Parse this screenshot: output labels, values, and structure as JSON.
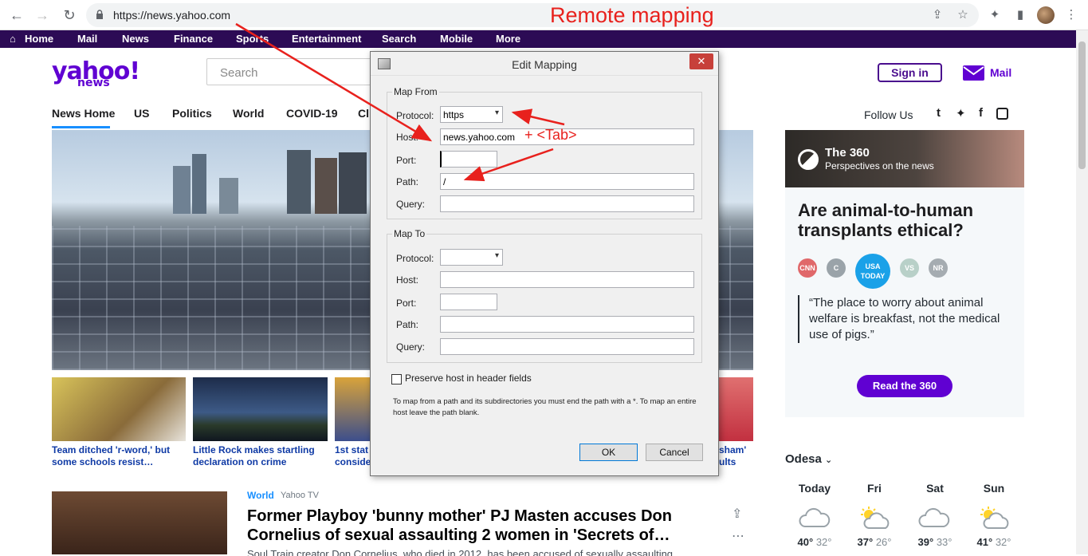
{
  "browser": {
    "url": "https://news.yahoo.com",
    "annotation": "Remote mapping"
  },
  "ynav": {
    "items": [
      "Home",
      "Mail",
      "News",
      "Finance",
      "Sports",
      "Entertainment",
      "Search",
      "Mobile",
      "More"
    ]
  },
  "header": {
    "logo": "yahoo!",
    "logo_sub": "news",
    "search_placeholder": "Search",
    "signin_label": "Sign in",
    "mail_label": "Mail"
  },
  "subnav": {
    "items": [
      "News Home",
      "US",
      "Politics",
      "World",
      "COVID-19",
      "Cli"
    ],
    "follow_label": "Follow Us"
  },
  "thumbs": [
    {
      "caption_line1": "Team ditched 'r-word,' but",
      "caption_line2": "some schools resist…"
    },
    {
      "caption_line1": "Little Rock makes startling",
      "caption_line2": "declaration on crime"
    },
    {
      "caption_line1": "1st stat",
      "caption_line2": "conside"
    },
    {
      "caption_line1": "sham'",
      "caption_line2": "ults"
    }
  ],
  "article": {
    "category": "World",
    "source": "Yahoo TV",
    "title": "Former Playboy 'bunny mother' PJ Masten accuses Don Cornelius of sexual assaulting 2 women in 'Secrets of…",
    "snippet": "Soul Train creator Don Cornelius, who died in 2012, has been accused of sexually assaulting"
  },
  "card360": {
    "title": "The 360",
    "subtitle": "Perspectives on the news",
    "question": "Are animal-to-human transplants ethical?",
    "sources": [
      "CNN",
      "C",
      "USA TODAY",
      "VS",
      "NR"
    ],
    "quote": "“The place to worry about animal welfare is breakfast, not the medical use of pigs.”",
    "button": "Read the 360"
  },
  "weather": {
    "city": "Odesa",
    "days": [
      {
        "day": "Today",
        "hi": "40°",
        "lo": "32°"
      },
      {
        "day": "Fri",
        "hi": "37°",
        "lo": "26°"
      },
      {
        "day": "Sat",
        "hi": "39°",
        "lo": "33°"
      },
      {
        "day": "Sun",
        "hi": "41°",
        "lo": "32°"
      }
    ]
  },
  "dialog": {
    "title": "Edit Mapping",
    "close": "✕",
    "map_from": {
      "label": "Map From",
      "protocol_label": "Protocol:",
      "protocol_value": "https",
      "host_label": "Host:",
      "host_value": "news.yahoo.com",
      "port_label": "Port:",
      "port_value": "",
      "path_label": "Path:",
      "path_value": "/",
      "query_label": "Query:",
      "query_value": ""
    },
    "map_to": {
      "label": "Map To",
      "protocol_label": "Protocol:",
      "protocol_value": "",
      "host_label": "Host:",
      "host_value": "",
      "port_label": "Port:",
      "port_value": "",
      "path_label": "Path:",
      "path_value": "",
      "query_label": "Query:",
      "query_value": ""
    },
    "preserve_label": "Preserve host in header fields",
    "hint": "To map from a path and its subdirectories you must end the path with a *. To map an entire host leave the path blank.",
    "ok_label": "OK",
    "cancel_label": "Cancel"
  },
  "annotations": {
    "tab_note": "+ <Tab>",
    "color": "#e8211d"
  }
}
